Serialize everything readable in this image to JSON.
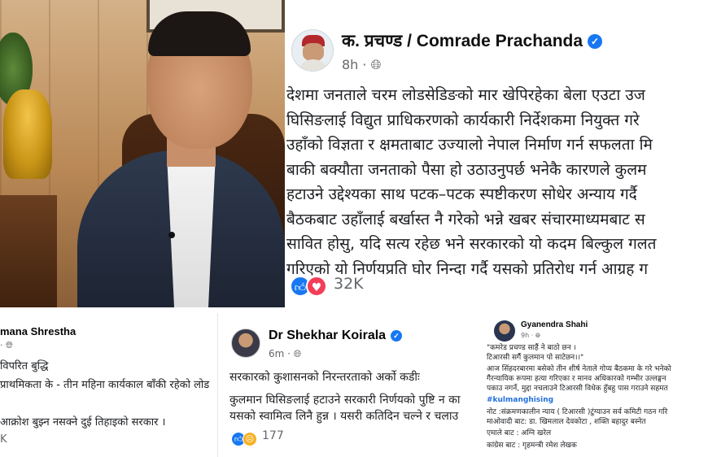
{
  "main_post": {
    "author": "क. प्रचण्ड / Comrade Prachanda",
    "verified_icon": "verified-badge-icon",
    "time": "8h · ",
    "audience_icon": "globe-icon",
    "lines": [
      "देशमा जनताले चरम लोडसेडिङको मार खेपिरहेका बेला एउटा उज",
      "घिसिङलाई विद्युत प्राधिकरणको कार्यकारी निर्देशकमा नियुक्त गरे",
      "उहाँको विज्ञता र क्षमताबाट उज्यालो नेपाल निर्माण गर्न सफलता मि",
      "बाकी बक्यौता जनताको पैसा हो उठाउनुपर्छ भनेकै कारणले कुलम",
      "हटाउने उद्देश्यका साथ पटक–पटक स्पष्टीकरण सोधेर अन्याय गर्दै",
      "बैठकबाट उहाँलाई बर्खास्त नै गरेको भन्ने खबर संचारमाध्यमबाट स",
      "सावित होसु, यदि सत्य रहेछ भने सरकारको यो कदम बिल्कुल गलत",
      "गरिएको यो निर्णयप्रति घोर निन्दा गर्दै यसको प्रतिरोध गर्न आग्रह ग"
    ],
    "reactions": {
      "like_icon": "like-reaction-icon",
      "love_icon": "love-reaction-icon",
      "count": "32K"
    }
  },
  "post_left": {
    "author": "mana Shrestha",
    "time": "· ",
    "lines": [
      "विपरित बुद्धि",
      "प्राथमिकता के - तीन महिना कार्यकाल बाँकी रहेको लोड",
      "आक्रोश बुझ्न नसक्ने दुई तिहाइको सरकार ।"
    ],
    "count": "K"
  },
  "post_middle": {
    "author": "Dr Shekhar Koirala",
    "time": "6m · ",
    "lines": [
      "सरकारको कुशासनको निरन्तरताको अर्को कडीः",
      "कुलमान घिसिङलाई हटाउने सरकारी निर्णयको पुष्टि न का",
      "यसको स्वामित्व लिनै हुन्न । यसरी कतिदिन चल्ने र चलाउ"
    ],
    "reactions": {
      "like_icon": "like-reaction-icon",
      "sad_icon": "sad-reaction-icon",
      "count": "177"
    }
  },
  "post_right": {
    "author": "Gyanendra Shahi",
    "time": "9h · ",
    "lines": [
      "\"कमरेड प्रचण्ड साहैं ने बाठो छन ।",
      " टिआरसी सर्गै कुलमान पो साटेछन।।\"",
      "आज सिंहदरबारमा बसेको तीन शीर्ष नेताले  गोप्य बैठकमा के गरे भनेको",
      "गैरन्यायिक रूपमा हत्या गरिएका र मानव अधिकारको गम्भीर उल्लङ्घन",
      "पकाउ नगर्ने, मुद्दा नचलाउने टिआरसी विधेक हुँबहु पास गराउने  सहमत",
      "#kulmanghising",
      " नोट :संक्रमणकालीन न्याय ( टिआरसी )टुंग्याउन सर्व कमिटी गठन गरि",
      " माओवादी बाट: डा. खिमलाल देवकोटा , शक्ति बहादुर बस्नेत",
      "एमाले बाट  : अग्नि खरेल",
      "कांग्रेस बाट : गृहमन्त्री रमेश लेखक"
    ]
  }
}
